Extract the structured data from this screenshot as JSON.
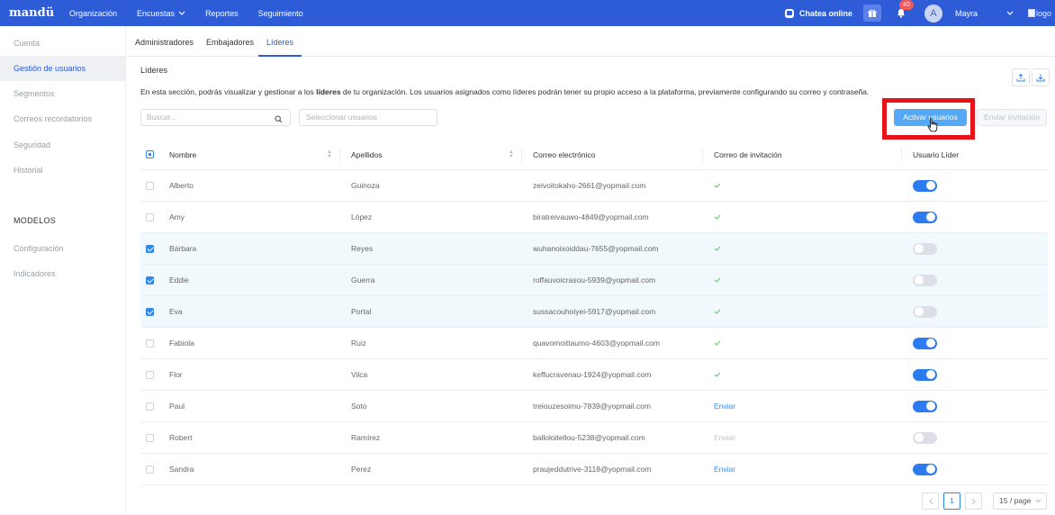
{
  "header": {
    "logo": "mandü",
    "nav": [
      {
        "label": "Organización"
      },
      {
        "label": "Encuestas",
        "dropdown": true
      },
      {
        "label": "Reportes"
      },
      {
        "label": "Seguimiento"
      }
    ],
    "chat_label": "Chatea online",
    "notifications_count": "40",
    "avatar_letter": "A",
    "user_name": "Mayra",
    "logo_img_alt": "logo",
    "colors": {
      "bar": "#2e5bd6",
      "badge": "#f25a5a"
    }
  },
  "sidebar": {
    "items": [
      {
        "label": "Cuenta",
        "active": false
      },
      {
        "label": "Gestión de usuarios",
        "active": true
      },
      {
        "label": "Segmentos",
        "active": false
      },
      {
        "label": "Correos recordatorios",
        "active": false
      },
      {
        "label": "Seguridad",
        "active": false
      },
      {
        "label": "Historial",
        "active": false
      }
    ],
    "section_title": "MODELOS",
    "section_items": [
      {
        "label": "Configuración"
      },
      {
        "label": "Indicadores"
      }
    ]
  },
  "tabs": [
    {
      "label": "Administradores",
      "active": false
    },
    {
      "label": "Embajadores",
      "active": false
    },
    {
      "label": "Líderes",
      "active": true
    }
  ],
  "main": {
    "title": "Líderes",
    "description_before": "En esta sección, podrás visualizar y gestionar a los ",
    "description_bold": "líderes",
    "description_after": " de tu organización. Los usuarios asignados como líderes podrán tener su propio acceso a la plataforma, previamente configurando su correo y contraseña.",
    "search_placeholder": "Buscar...",
    "select_placeholder": "Seleccionar usuarios",
    "activate_label": "Activar usuarios",
    "send_invite_label": "Enviar invitación"
  },
  "table": {
    "columns": [
      "Nombre",
      "Apellidos",
      "Correo electrónico",
      "Correo de invitación",
      "Usuario Líder"
    ],
    "rows": [
      {
        "selected": false,
        "nombre": "Alberto",
        "apellidos": "Guinoza",
        "correo": "zeivoitokaho-2661@yopmail.com",
        "invitacion": "check",
        "lider": true
      },
      {
        "selected": false,
        "nombre": "Amy",
        "apellidos": "López",
        "correo": "biratreivauwo-4849@yopmail.com",
        "invitacion": "check",
        "lider": true
      },
      {
        "selected": true,
        "nombre": "Bárbara",
        "apellidos": "Reyes",
        "correo": "wuhanoixoiddau-7655@yopmail.com",
        "invitacion": "check",
        "lider": false
      },
      {
        "selected": true,
        "nombre": "Eddie",
        "apellidos": "Guerra",
        "correo": "roffauvoicrasou-5939@yopmail.com",
        "invitacion": "check",
        "lider": false
      },
      {
        "selected": true,
        "nombre": "Eva",
        "apellidos": "Portal",
        "correo": "sussacouhoiyei-5917@yopmail.com",
        "invitacion": "check",
        "lider": false
      },
      {
        "selected": false,
        "nombre": "Fabiola",
        "apellidos": "Ruiz",
        "correo": "quavomoittaumo-4603@yopmail.com",
        "invitacion": "check",
        "lider": true
      },
      {
        "selected": false,
        "nombre": "Flor",
        "apellidos": "Vilca",
        "correo": "keffucravenau-1924@yopmail.com",
        "invitacion": "check",
        "lider": true
      },
      {
        "selected": false,
        "nombre": "Paul",
        "apellidos": "Soto",
        "correo": "treiouzesoimu-7839@yopmail.com",
        "invitacion": "Enviar",
        "lider": true
      },
      {
        "selected": false,
        "nombre": "Robert",
        "apellidos": "Ramírez",
        "correo": "balloloitellou-5238@yopmail.com",
        "invitacion": "Enviar-disabled",
        "lider": false
      },
      {
        "selected": false,
        "nombre": "Sandra",
        "apellidos": "Perez",
        "correo": "praujeddutrive-3118@yopmail.com",
        "invitacion": "Enviar",
        "lider": true
      }
    ]
  },
  "pagination": {
    "current_page": "1",
    "per_page": "15 / page"
  }
}
